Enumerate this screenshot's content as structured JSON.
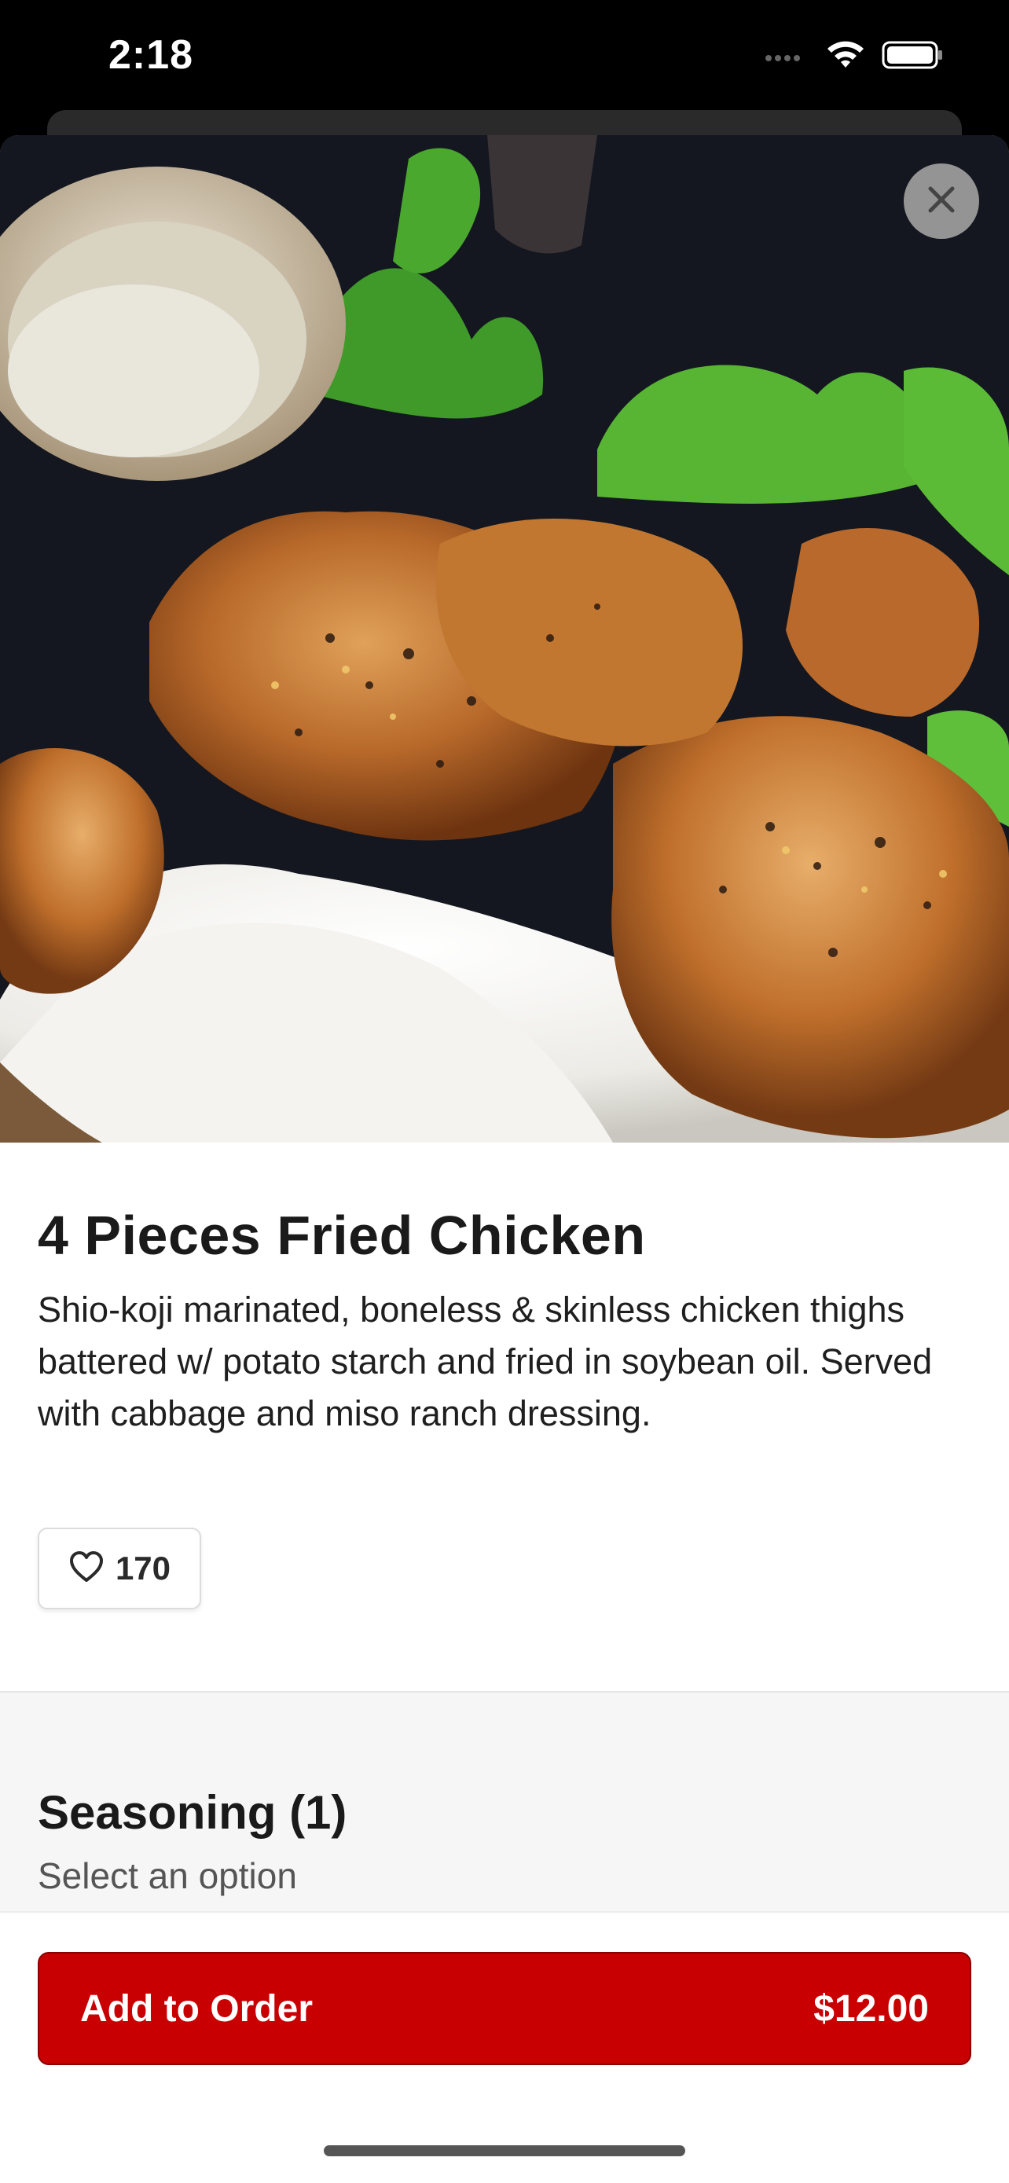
{
  "status_bar": {
    "time": "2:18"
  },
  "item": {
    "title": "4 Pieces Fried Chicken",
    "description": "Shio-koji marinated, boneless & skinless chicken thighs battered w/ potato starch and fried in soybean oil. Served with cabbage and miso ranch dressing.",
    "likes": "170",
    "image_alt": "fried-chicken-over-rice-photo"
  },
  "options": {
    "group_title": "Seasoning (1)",
    "group_subtitle": "Select an option"
  },
  "footer": {
    "add_label": "Add to Order",
    "price": "$12.00"
  },
  "colors": {
    "brand": "#c90002"
  },
  "icons": {
    "close": "close-icon",
    "like": "heart-icon"
  }
}
